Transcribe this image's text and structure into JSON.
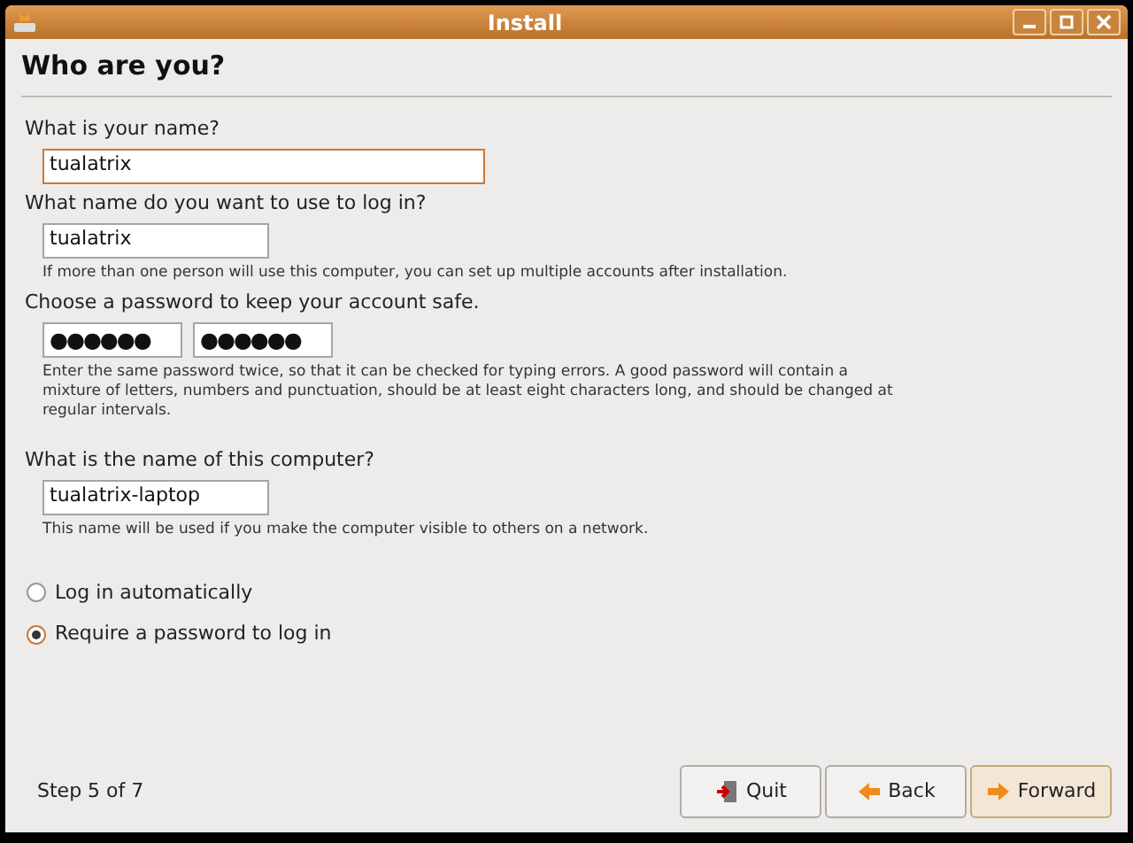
{
  "window": {
    "title": "Install"
  },
  "heading": "Who are you?",
  "sections": [
    {
      "label": "What is your name?",
      "fields": [
        {
          "value": "tualatrix",
          "kind": "text",
          "focused": true,
          "wide": true
        }
      ]
    },
    {
      "label": "What name do you want to use to log in?",
      "fields": [
        {
          "value": "tualatrix",
          "kind": "text",
          "focused": false,
          "wide": false
        }
      ],
      "hint": "If more than one person will use this computer, you can set up multiple accounts after installation."
    },
    {
      "label": "Choose a password to keep your account safe.",
      "fields": [
        {
          "value": "●●●●●●",
          "kind": "password",
          "focused": false,
          "wide": false
        },
        {
          "value": "●●●●●●",
          "kind": "password",
          "focused": false,
          "wide": false
        }
      ],
      "hint": "Enter the same password twice, so that it can be checked for typing errors. A good password will contain a mixture of letters, numbers and punctuation, should be at least eight characters long, and should be changed at regular intervals."
    },
    {
      "label": "What is the name of this computer?",
      "fields": [
        {
          "value": "tualatrix-laptop",
          "kind": "text",
          "focused": false,
          "wide": false
        }
      ],
      "hint": "This name will be used if you make the computer visible to others on a network."
    }
  ],
  "login_options": [
    {
      "label": "Log in automatically",
      "selected": false
    },
    {
      "label": "Require a password to log in",
      "selected": true
    }
  ],
  "status": "Step 5 of 7",
  "buttons": [
    {
      "label": "Quit",
      "kind": "quit"
    },
    {
      "label": "Back",
      "kind": "back"
    },
    {
      "label": "Forward",
      "kind": "forward",
      "default": true
    }
  ]
}
